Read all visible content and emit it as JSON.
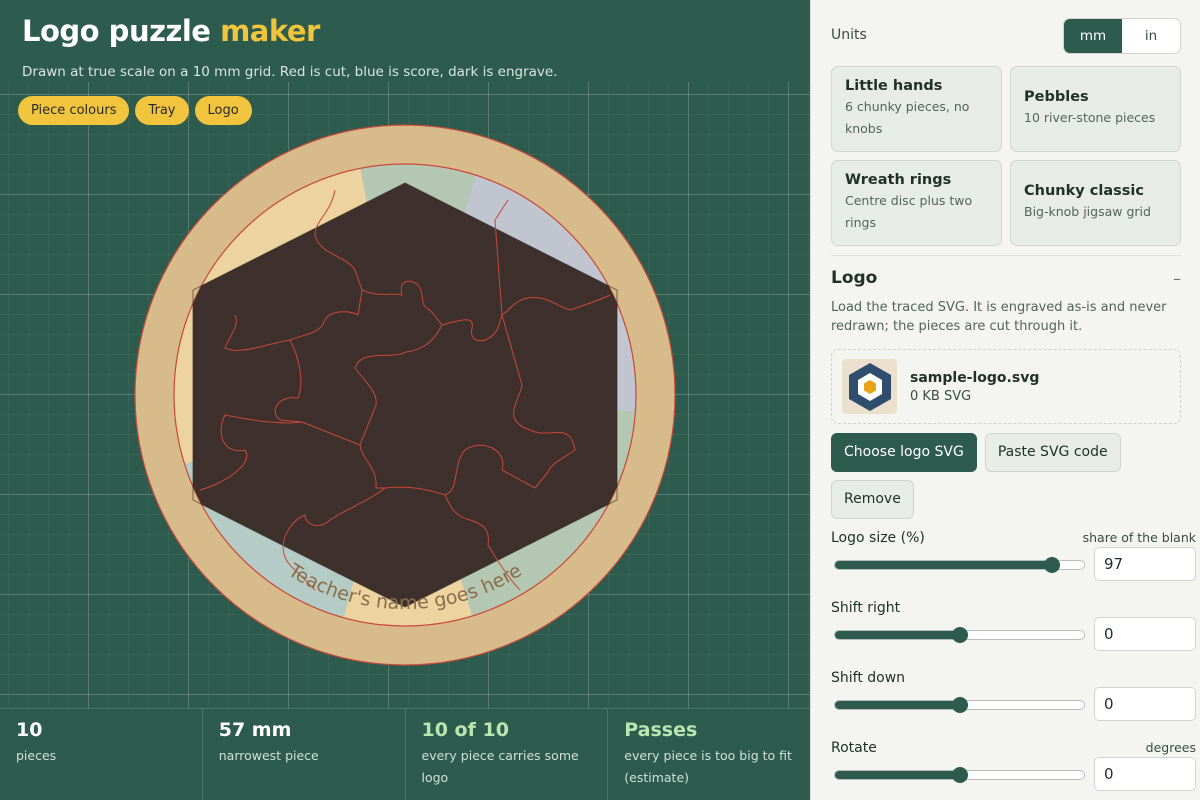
{
  "header": {
    "title_main": "Logo puzzle ",
    "title_accent": "maker",
    "subtitle": "Drawn at true scale on a 10 mm grid. Red is cut, blue is score, dark is engrave."
  },
  "chips": [
    "Piece colours",
    "Tray",
    "Logo"
  ],
  "preview": {
    "curved_text": "Teacher's name goes here"
  },
  "stats": [
    {
      "value": "10",
      "label": "pieces",
      "highlight": false
    },
    {
      "value": "57 mm",
      "label": "narrowest piece",
      "highlight": false
    },
    {
      "value": "10 of 10",
      "label": "every piece carries some logo",
      "highlight": true
    },
    {
      "value": "Passes",
      "label": "every piece is too big to fit (estimate)",
      "highlight": true
    }
  ],
  "panel": {
    "units_label": "Units",
    "units_options": [
      "mm",
      "in"
    ],
    "units_selected": "mm",
    "presets": [
      {
        "name": "Little hands",
        "desc": "6 chunky pieces, no knobs"
      },
      {
        "name": "Pebbles",
        "desc": "10 river-stone pieces"
      },
      {
        "name": "Wreath rings",
        "desc": "Centre disc plus two rings"
      },
      {
        "name": "Chunky classic",
        "desc": "Big-knob jigsaw grid"
      }
    ],
    "logo": {
      "heading": "Logo",
      "collapse_glyph": "–",
      "description": "Load the traced SVG. It is engraved as-is and never redrawn; the pieces are cut through it.",
      "file_name": "sample-logo.svg",
      "file_size": "0 KB SVG",
      "choose_label": "Choose logo SVG",
      "paste_label": "Paste SVG code",
      "remove_label": "Remove"
    },
    "controls": [
      {
        "label": "Logo size (%)",
        "hint": "share of the blank",
        "value": "97",
        "fraction": 0.87
      },
      {
        "label": "Shift right",
        "hint": "",
        "value": "0",
        "fraction": 0.5
      },
      {
        "label": "Shift down",
        "hint": "",
        "value": "0",
        "fraction": 0.5
      },
      {
        "label": "Rotate",
        "hint": "degrees",
        "value": "0",
        "fraction": 0.5
      }
    ]
  },
  "colors": {
    "background": "#2d5b4d",
    "accent": "#f0c43c",
    "tray": "#d8bb8b",
    "logo_dark": "#3e302c",
    "cut_line": "#c9483a",
    "success": "#b9e6b0",
    "panel_bg": "#f4f5f1"
  },
  "icons": [
    "logo-thumbnail-icon",
    "collapse-icon"
  ]
}
